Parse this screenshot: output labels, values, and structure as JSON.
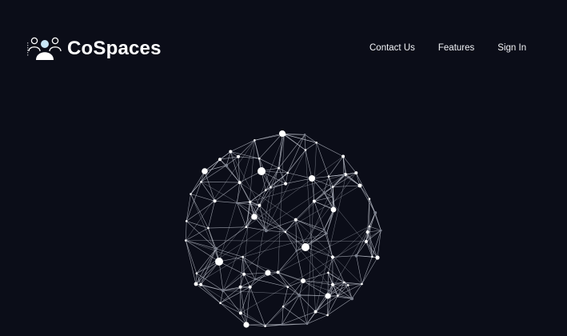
{
  "brand": {
    "name": "CoSpaces",
    "logo_icon": "team-users-icon"
  },
  "nav": {
    "items": [
      {
        "label": "Contact Us"
      },
      {
        "label": "Features"
      },
      {
        "label": "Sign In"
      }
    ]
  },
  "hero": {
    "graphic_icon": "network-globe-icon"
  },
  "colors": {
    "background": "#0b0d18",
    "text": "#ffffff",
    "network_line": "#c9cdd8",
    "node": "#ffffff",
    "node_dim": "#7a7f8c"
  }
}
